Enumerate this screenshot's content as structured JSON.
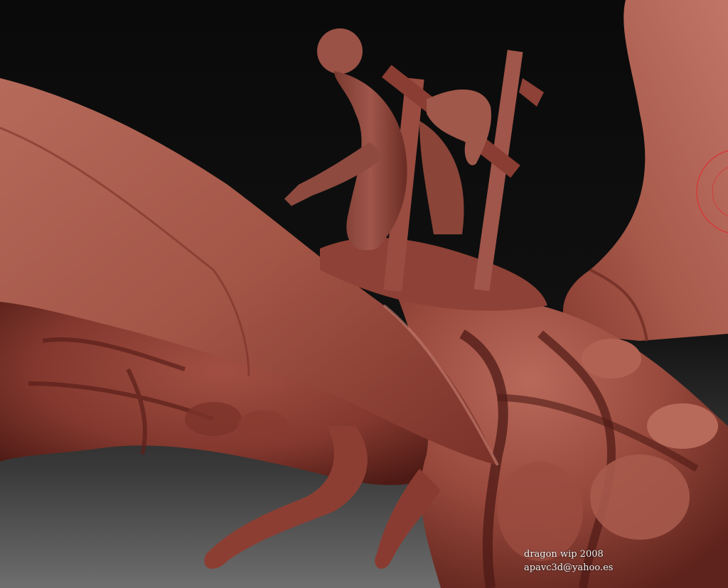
{
  "caption": {
    "title": "dragon wip 2008",
    "email": "apavc3d@yahoo.es"
  },
  "colors": {
    "background_top": "#0a0a0a",
    "background_bottom": "#6e6e6e",
    "clay_light": "#b06455",
    "clay_mid": "#8e4136",
    "clay_dark": "#5a1f19",
    "caption_text": "#f2f2f2",
    "brush_ring": "#d43a3a"
  }
}
